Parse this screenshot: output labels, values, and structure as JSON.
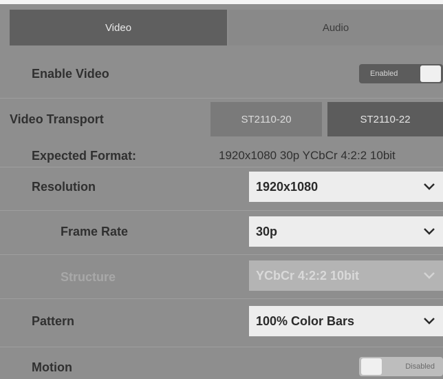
{
  "tabs": {
    "video": "Video",
    "audio": "Audio"
  },
  "enable_video": {
    "label": "Enable Video",
    "toggle_text": "Enabled"
  },
  "video_transport": {
    "label": "Video Transport",
    "options": [
      "ST2110-20",
      "ST2110-22"
    ],
    "selected": "ST2110-22"
  },
  "expected_format": {
    "label": "Expected Format:",
    "value": "1920x1080 30p YCbCr 4:2:2 10bit"
  },
  "resolution": {
    "label": "Resolution",
    "value": "1920x1080"
  },
  "frame_rate": {
    "label": "Frame Rate",
    "value": "30p"
  },
  "structure": {
    "label": "Structure",
    "value": "YCbCr 4:2:2 10bit"
  },
  "pattern": {
    "label": "Pattern",
    "value": "100% Color Bars"
  },
  "motion": {
    "label": "Motion",
    "toggle_text": "Disabled"
  },
  "icons": {
    "dropdown": "chevron-down-icon"
  }
}
